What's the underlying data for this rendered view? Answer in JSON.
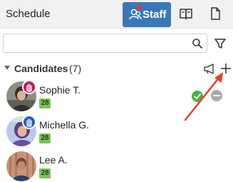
{
  "header": {
    "title": "Schedule",
    "staff_label": "Staff",
    "book_icon": "book-icon",
    "document_icon": "document-icon",
    "accent_color": "#3a77b8"
  },
  "search": {
    "value": "",
    "placeholder": "",
    "icon": "search-icon",
    "filter_icon": "filter-icon"
  },
  "candidates": {
    "title": "Candidates",
    "count": "(7)",
    "items": [
      {
        "name": "Sophie T.",
        "badge": "28",
        "hand_color": "#c2185b",
        "status": "check"
      },
      {
        "name": "Michella G.",
        "badge": "28",
        "hand_color": "#1e63b0"
      },
      {
        "name": "Lee A.",
        "badge": "28"
      }
    ]
  },
  "colors": {
    "badge": "#7dc25a",
    "check": "#4caf50",
    "remove": "#a9a9a9",
    "annotation_arrow": "#e53f2a"
  }
}
